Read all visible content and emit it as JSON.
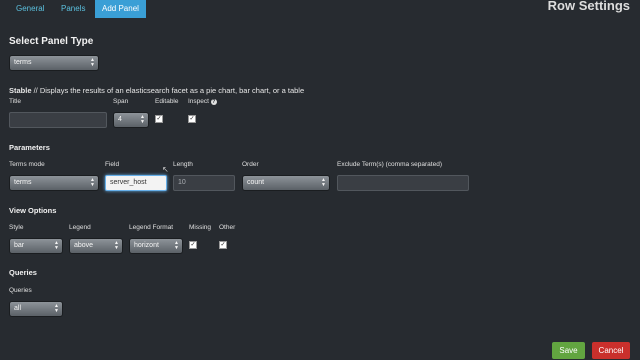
{
  "tabs": [
    {
      "label": "General"
    },
    {
      "label": "Panels"
    },
    {
      "label": "Add Panel"
    }
  ],
  "header": {
    "title": "Row Settings"
  },
  "panel_type": {
    "heading": "Select Panel Type",
    "selected": "terms",
    "stable": "Stable",
    "description": " // Displays the results of an elasticsearch facet as a pie chart, bar chart, or a table"
  },
  "general_fields": {
    "title_label": "Title",
    "title_value": "",
    "span_label": "Span",
    "span_value": "4",
    "editable_label": "Editable",
    "editable_checked": true,
    "inspect_label": "Inspect",
    "inspect_icon": "question-circle-icon",
    "inspect_checked": true
  },
  "parameters": {
    "heading": "Parameters",
    "terms_mode_label": "Terms mode",
    "terms_mode_value": "terms",
    "field_label": "Field",
    "field_value": "server_host",
    "length_label": "Length",
    "length_value": "10",
    "order_label": "Order",
    "order_value": "count",
    "exclude_label": "Exclude Term(s) (comma separated)",
    "exclude_value": ""
  },
  "view_options": {
    "heading": "View Options",
    "style_label": "Style",
    "style_value": "bar",
    "legend_label": "Legend",
    "legend_value": "above",
    "legend_format_label": "Legend Format",
    "legend_format_value": "horizont",
    "missing_label": "Missing",
    "missing_checked": true,
    "other_label": "Other",
    "other_checked": true
  },
  "queries": {
    "heading": "Queries",
    "label": "Queries",
    "value": "all"
  },
  "footer": {
    "save_label": "Save",
    "cancel_label": "Cancel"
  },
  "colors": {
    "background": "#272b30",
    "accent": "#3a9fd6",
    "save": "#62a540",
    "cancel": "#c9302c"
  }
}
